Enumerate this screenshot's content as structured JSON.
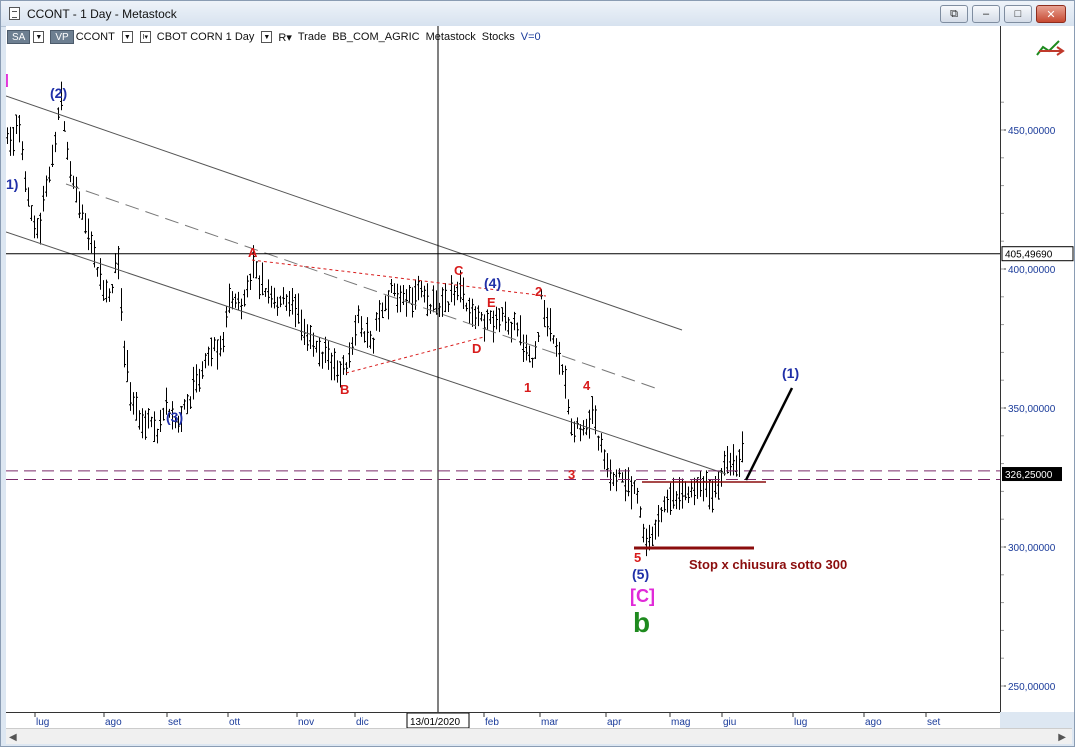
{
  "window": {
    "title": "CCONT - 1 Day - Metastock",
    "buttons": {
      "restore": "⧉",
      "minimize": "–",
      "maximize": "□",
      "close": "✕"
    }
  },
  "toolbar": {
    "chip_sa": "SA",
    "chip_vp": "VP",
    "symbol": "CCONT",
    "instrument": "CBOT CORN  1 Day",
    "r_chip": "R▾",
    "trade": "Trade",
    "category": "BB_COM_AGRIC",
    "source": "Metastock",
    "type": "Stocks",
    "volume": "V=0"
  },
  "chart_data": {
    "type": "bar",
    "price_labels": [
      "450,00000",
      "400,00000",
      "350,00000",
      "300,00000",
      "250,00000"
    ],
    "price_values": [
      450,
      400,
      350,
      300,
      250
    ],
    "crosshair_price": "405,49690",
    "crosshair_date": "13/01/2020",
    "last_price": "326,25000",
    "level_labels": [
      "327,40443",
      "324,32525"
    ],
    "months": [
      "lug",
      "ago",
      "set",
      "ott",
      "nov",
      "dic",
      "feb",
      "mar",
      "apr",
      "mag",
      "giu",
      "lug",
      "ago",
      "set"
    ],
    "wave_labels": {
      "w2": "(2)",
      "w1": "1)",
      "w3": "(3)",
      "w4": "(4)",
      "w5": "(5)",
      "wA": "A",
      "wB": "B",
      "wC": "C",
      "wD": "D",
      "wE": "E",
      "s1": "1",
      "s2": "2",
      "s3": "3",
      "s4": "4",
      "s5": "5",
      "next1": "(1)",
      "bigC": "[C]",
      "bigb": "b",
      "edge": "]"
    },
    "annotation": "Stop x chiusura sotto 300",
    "colors": {
      "blue": "#1f2fa8",
      "red": "#d81b1b",
      "magenta": "#e02ad8",
      "green": "#1e8a1e",
      "darkred": "#8b0d0d"
    }
  }
}
